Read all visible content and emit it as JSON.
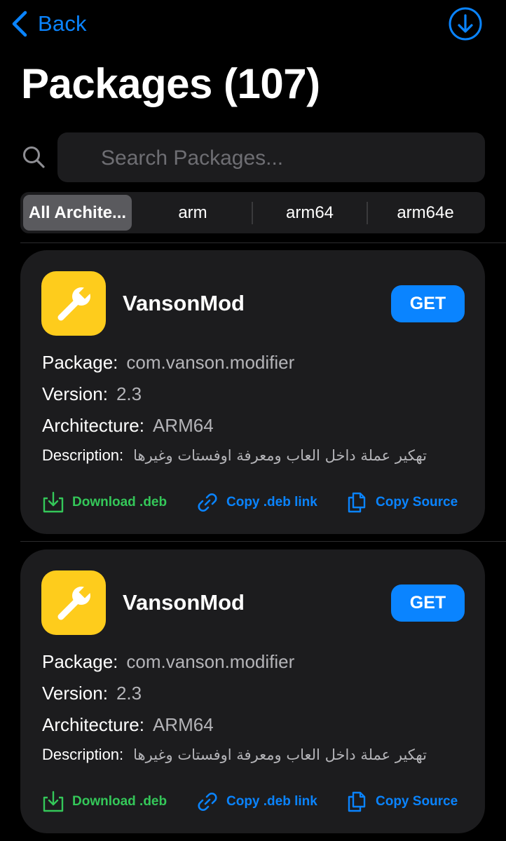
{
  "nav": {
    "back_label": "Back"
  },
  "header": {
    "title": "Packages (107)"
  },
  "search": {
    "placeholder": "Search Packages...",
    "value": ""
  },
  "filters": {
    "segments": [
      "All Archite...",
      "arm",
      "arm64",
      "arm64e"
    ],
    "selected": "All Archite..."
  },
  "field_labels": {
    "package": "Package:",
    "version": "Version:",
    "architecture": "Architecture:",
    "description": "Description:"
  },
  "packages": [
    {
      "name": "VansonMod",
      "get_label": "GET",
      "package": "com.vanson.modifier",
      "version": "2.3",
      "architecture": "ARM64",
      "description": "تهكير عملة داخل العاب ومعرفة اوفستات وغيرها",
      "actions": {
        "download": "Download .deb",
        "copy_link": "Copy .deb link",
        "copy_source": "Copy Source"
      }
    },
    {
      "name": "VansonMod",
      "get_label": "GET",
      "package": "com.vanson.modifier",
      "version": "2.3",
      "architecture": "ARM64",
      "description": "تهكير عملة داخل العاب ومعرفة اوفستات وغيرها",
      "actions": {
        "download": "Download .deb",
        "copy_link": "Copy .deb link",
        "copy_source": "Copy Source"
      }
    }
  ],
  "colors": {
    "background": "#000000",
    "card": "#1c1c1e",
    "accent_blue": "#0a84ff",
    "accent_green": "#34c759",
    "icon_yellow": "#fecc1c"
  },
  "icons": {
    "back": "chevron-left-icon",
    "download_top": "download-circle-icon",
    "search": "search-icon",
    "app": "wrench-icon",
    "download": "download-tray-icon",
    "link": "link-icon",
    "copy": "copy-document-icon"
  }
}
